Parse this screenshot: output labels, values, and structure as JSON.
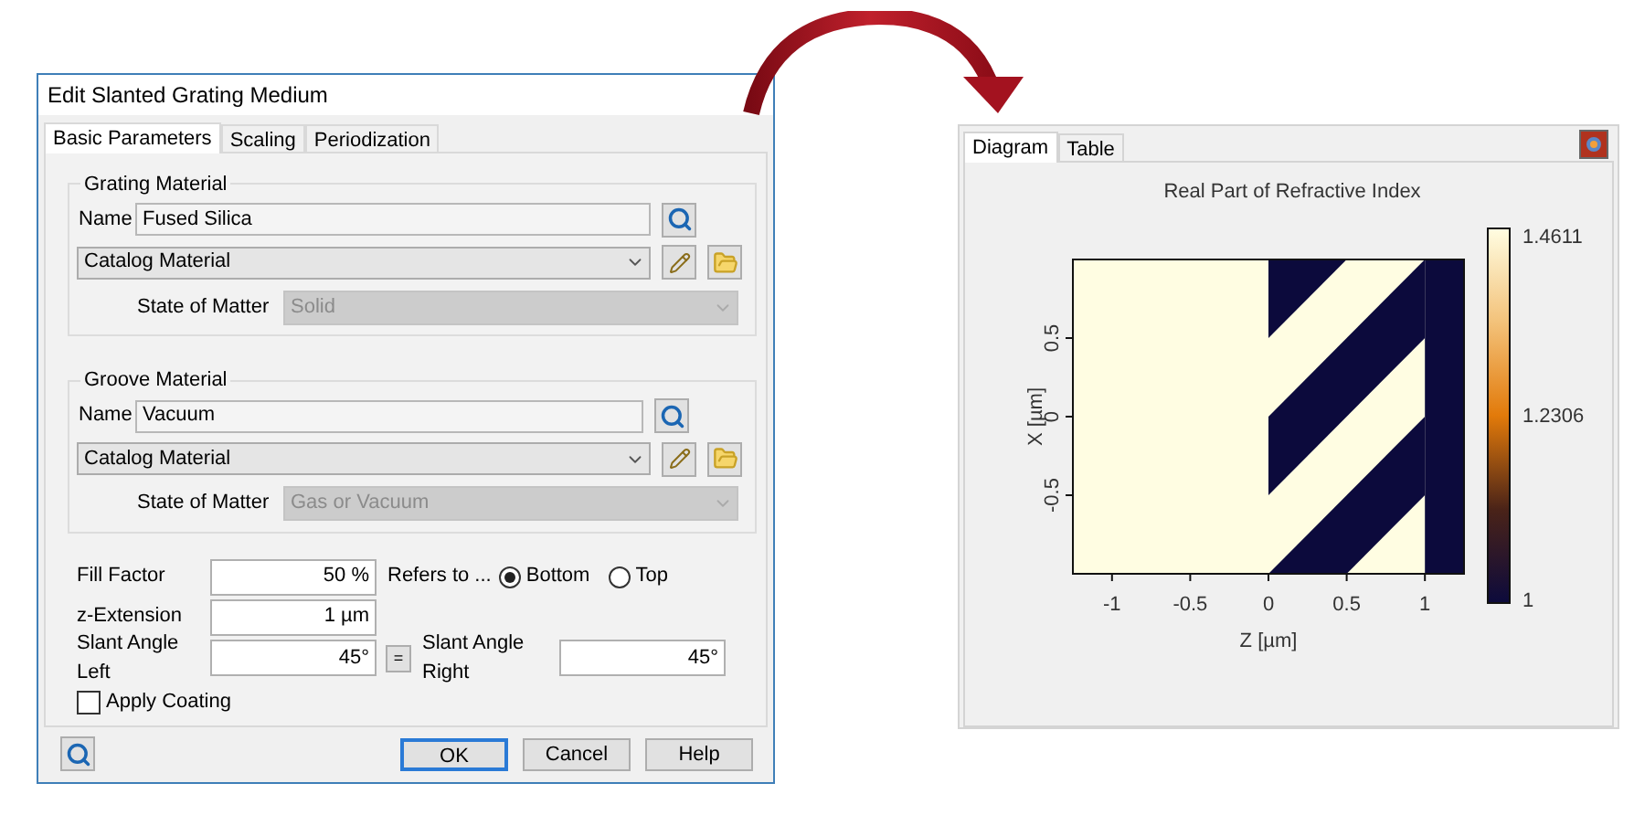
{
  "dialog": {
    "title": "Edit Slanted Grating Medium",
    "tabs": [
      {
        "label": "Basic Parameters",
        "selected": true
      },
      {
        "label": "Scaling",
        "selected": false
      },
      {
        "label": "Periodization",
        "selected": false
      }
    ],
    "material_groups": [
      {
        "title": "Grating Material",
        "name_label": "Name",
        "name_value": "Fused Silica",
        "source": "Catalog Material",
        "state_label": "State of Matter",
        "state_value": "Solid",
        "state_disabled": true
      },
      {
        "title": "Groove Material",
        "name_label": "Name",
        "name_value": "Vacuum",
        "source": "Catalog Material",
        "state_label": "State of Matter",
        "state_value": "Gas or Vacuum",
        "state_disabled": true
      }
    ],
    "fill_factor": {
      "label": "Fill Factor",
      "value": "50 %",
      "refers_label": "Refers to ...",
      "options": [
        {
          "label": "Bottom",
          "selected": true
        },
        {
          "label": "Top",
          "selected": false
        }
      ]
    },
    "z_extension": {
      "label": "z-Extension",
      "value": "1 µm"
    },
    "slant_left": {
      "label": "Slant Angle Left",
      "value": "45°"
    },
    "equal_button": "=",
    "slant_right": {
      "label": "Slant Angle Right",
      "value": "45°"
    },
    "apply_coating": {
      "label": "Apply Coating",
      "checked": false
    },
    "buttons": [
      {
        "label": "OK",
        "default": true
      },
      {
        "label": "Cancel",
        "default": false
      },
      {
        "label": "Help",
        "default": false
      }
    ]
  },
  "viewer": {
    "tabs": [
      {
        "label": "Diagram",
        "selected": true
      },
      {
        "label": "Table",
        "selected": false
      }
    ],
    "plot": {
      "title": "Real Part of Refractive Index",
      "xlabel": "Z [µm]",
      "ylabel": "X [µm]",
      "xtick_labels": [
        "-1",
        "-0.5",
        "0",
        "0.5",
        "1"
      ],
      "ytick_labels": [
        "0.5",
        "0",
        "-0.5"
      ],
      "colorbar_labels": [
        "1.4611",
        "1.2306",
        "1"
      ]
    }
  }
}
